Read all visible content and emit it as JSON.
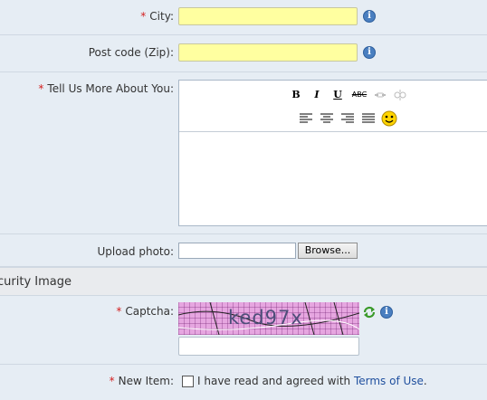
{
  "form": {
    "city": {
      "label": "City:",
      "required": "*"
    },
    "postcode": {
      "label": "Post code (Zip):"
    },
    "about": {
      "label": "Tell Us More About You:",
      "required": "*"
    },
    "editor": {
      "toolbar_row1": [
        {
          "name": "bold-button",
          "glyph": "B"
        },
        {
          "name": "italic-button",
          "glyph": "I"
        },
        {
          "name": "underline-button",
          "glyph": "U"
        },
        {
          "name": "strikethrough-button",
          "glyph": "ABC"
        },
        {
          "name": "link-button",
          "glyph": "link-icon"
        },
        {
          "name": "unlink-button",
          "glyph": "unlink-icon"
        }
      ],
      "toolbar_row2": [
        {
          "name": "align-left-button",
          "glyph": "align-left-icon"
        },
        {
          "name": "align-center-button",
          "glyph": "align-center-icon"
        },
        {
          "name": "align-right-button",
          "glyph": "align-right-icon"
        },
        {
          "name": "justify-button",
          "glyph": "justify-icon"
        },
        {
          "name": "smiley-button",
          "glyph": "smiley-icon"
        }
      ]
    },
    "upload": {
      "label": "Upload photo:",
      "browse": "Browse..."
    },
    "security_section": {
      "title": "curity Image"
    },
    "captcha": {
      "label": "Captcha:",
      "required": "*",
      "image_text": "ked97x"
    },
    "new_item": {
      "label": "New Item:",
      "required": "*",
      "agree_text": "I have read and agreed with ",
      "terms_link": "Terms of Use",
      "period": "."
    }
  },
  "colors": {
    "background": "#e6edf4",
    "input_highlight": "#ffffa0",
    "required": "#d42020",
    "link": "#1f4f9e"
  }
}
